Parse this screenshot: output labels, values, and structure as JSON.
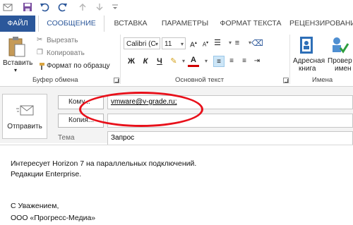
{
  "quick_access": {
    "icons": [
      "outlook-mail-icon",
      "save-icon",
      "undo-icon",
      "redo-icon",
      "up-arrow-icon",
      "down-arrow-icon",
      "customize-icon"
    ]
  },
  "tabs": [
    {
      "label": "ФАЙЛ"
    },
    {
      "label": "СООБЩЕНИЕ"
    },
    {
      "label": "ВСТАВКА"
    },
    {
      "label": "ПАРАМЕТРЫ"
    },
    {
      "label": "ФОРМАТ ТЕКСТА"
    },
    {
      "label": "РЕЦЕНЗИРОВАНИ"
    }
  ],
  "ribbon": {
    "clipboard": {
      "paste_label": "Вставить",
      "cut_label": "Вырезать",
      "copy_label": "Копировать",
      "format_painter_label": "Формат по образцу",
      "group_label": "Буфер обмена"
    },
    "basic_text": {
      "font_name": "Calibri (С",
      "font_size": "11",
      "bold": "Ж",
      "italic": "К",
      "underline": "Ч",
      "group_label": "Основной текст"
    },
    "names": {
      "address_book_label_1": "Адресная",
      "address_book_label_2": "книга",
      "check_names_label_1": "Провер",
      "check_names_label_2": "имен",
      "group_label": "Имена"
    }
  },
  "compose": {
    "send_label": "Отправить",
    "to_button": "Кому...",
    "to_value": "vmware@v-grade.ru;",
    "cc_button": "Копия...",
    "cc_value": "",
    "subject_label": "Тема",
    "subject_value": "Запрос"
  },
  "body": {
    "lines": [
      "Интересует Horizon 7 на параллельных подключений.",
      "Редакции Enterprise.",
      "",
      "С Уважением,",
      "ООО «Прогресс-Медиа»"
    ]
  },
  "annotation_color": "#e8101a",
  "accent_color": "#2b579a"
}
